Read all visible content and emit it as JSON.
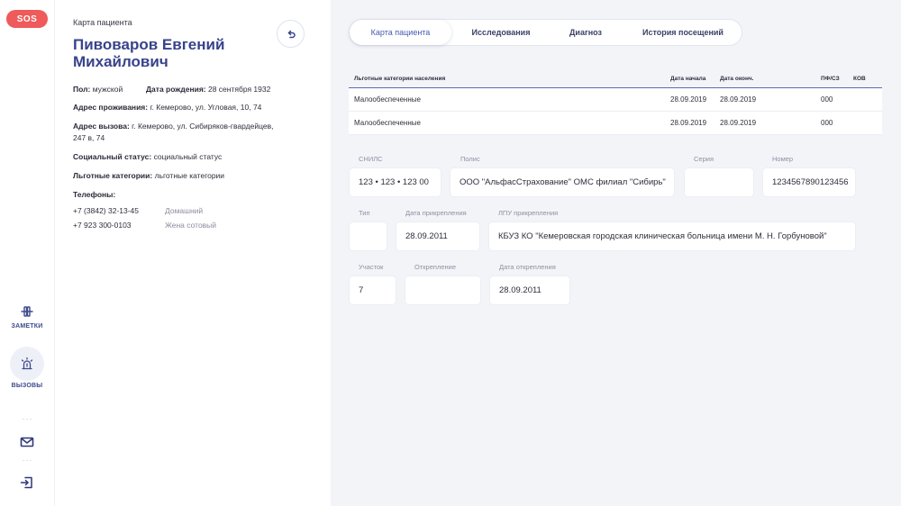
{
  "rail": {
    "sos_label": "SOS",
    "notes_label": "ЗАМЕТКИ",
    "calls_label": "ВЫЗОВЫ",
    "dots": "···",
    "icons": [
      "notes-icon",
      "siren-icon",
      "mail-icon",
      "logout-icon"
    ]
  },
  "patient": {
    "caption": "Карта пациента",
    "name": "Пивоваров Евгений Михайлович",
    "gender_label": "Пол:",
    "gender": "мужской",
    "birth_label": "Дата рождения:",
    "birth": "28 сентября 1932",
    "residence_label": "Адрес проживания:",
    "residence": "г. Кемерово, ул. Угловая, 10, 74",
    "call_address_label": "Адрес вызова:",
    "call_address": "г. Кемерово, ул. Сибиряков-гвардейцев, 247 в, 74",
    "social_label": "Социальный статус:",
    "social": "социальный статус",
    "benefit_label": "Льготные категории:",
    "benefit": "льготные категории",
    "phones_label": "Телефоны:",
    "phones": [
      {
        "number": "+7 (3842) 32-13-45",
        "type": "Домашний"
      },
      {
        "number": "+7 923 300-0103",
        "type": "Жена сотовый"
      }
    ]
  },
  "tabs": [
    "Карта пациента",
    "Исследования",
    "Диагноз",
    "История посещений"
  ],
  "benefits_table": {
    "headers": [
      "Льготные категории населения",
      "Дата начала",
      "Дата оконч.",
      "ПФ/СЗ",
      "КОВ"
    ],
    "rows": [
      [
        "Малообеспеченные",
        "28.09.2019",
        "28.09.2019",
        "000",
        ""
      ],
      [
        "Малообеспеченные",
        "28.09.2019",
        "28.09.2019",
        "000",
        ""
      ]
    ]
  },
  "fields": {
    "snils_label": "СНИЛС",
    "snils": "123 • 123 • 123  00",
    "policy_label": "Полис",
    "policy": "ООО \"АльфасСтрахование\" ОМС филиал \"Сибирь\"",
    "series_label": "Серия",
    "series": "",
    "number_label": "Номер",
    "number": "1234567890123456",
    "type_label": "Тип",
    "type": "",
    "attach_date_label": "Дата прикрепления",
    "attach_date": "28.09.2011",
    "lpu_label": "ЛПУ прикрепления",
    "lpu": "КБУЗ КО \"Кемеровская городская клиническая больница имени М. Н. Горбуновой\"",
    "district_label": "Участок",
    "district": "7",
    "detach_label": "Открепление",
    "detach": "",
    "detach_date_label": "Дата открепления",
    "detach_date": "28.09.2011"
  },
  "colors": {
    "accent": "#38438a",
    "sos": "#ef5a5a",
    "background": "#f3f4f8"
  }
}
